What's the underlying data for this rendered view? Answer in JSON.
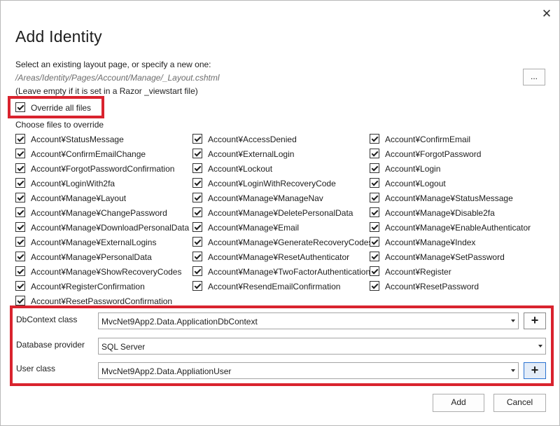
{
  "dialog": {
    "close_glyph": "✕",
    "title": "Add Identity",
    "layout_prompt": "Select an existing layout page, or specify a new one:",
    "layout_path": "/Areas/Identity/Pages/Account/Manage/_Layout.cshtml",
    "layout_hint": "(Leave empty if it is set in a Razor _viewstart file)",
    "browse_label": "...",
    "override_all_label": "Override all files",
    "choose_label": "Choose files to override",
    "files": {
      "col1": [
        "Account¥StatusMessage",
        "Account¥ConfirmEmailChange",
        "Account¥ForgotPasswordConfirmation",
        "Account¥LoginWith2fa",
        "Account¥Manage¥Layout",
        "Account¥Manage¥ChangePassword",
        "Account¥Manage¥DownloadPersonalData",
        "Account¥Manage¥ExternalLogins",
        "Account¥Manage¥PersonalData",
        "Account¥Manage¥ShowRecoveryCodes",
        "Account¥RegisterConfirmation",
        "Account¥ResetPasswordConfirmation"
      ],
      "col2": [
        "Account¥AccessDenied",
        "Account¥ExternalLogin",
        "Account¥Lockout",
        "Account¥LoginWithRecoveryCode",
        "Account¥Manage¥ManageNav",
        "Account¥Manage¥DeletePersonalData",
        "Account¥Manage¥Email",
        "Account¥Manage¥GenerateRecoveryCodes",
        "Account¥Manage¥ResetAuthenticator",
        "Account¥Manage¥TwoFactorAuthentication",
        "Account¥ResendEmailConfirmation"
      ],
      "col3": [
        "Account¥ConfirmEmail",
        "Account¥ForgotPassword",
        "Account¥Login",
        "Account¥Logout",
        "Account¥Manage¥StatusMessage",
        "Account¥Manage¥Disable2fa",
        "Account¥Manage¥EnableAuthenticator",
        "Account¥Manage¥Index",
        "Account¥Manage¥SetPassword",
        "Account¥Register",
        "Account¥ResetPassword"
      ]
    },
    "dbcontext": {
      "label": "DbContext class",
      "value": "MvcNet9App2.Data.ApplicationDbContext",
      "plus": "+"
    },
    "provider": {
      "label": "Database provider",
      "value": "SQL Server"
    },
    "userclass": {
      "label": "User class",
      "value": "MvcNet9App2.Data.AppliationUser",
      "plus": "+"
    },
    "add_label": "Add",
    "cancel_label": "Cancel"
  }
}
